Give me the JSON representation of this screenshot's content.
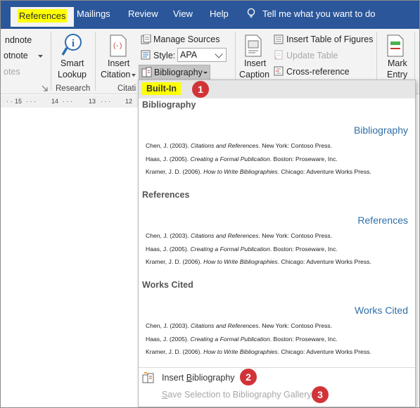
{
  "tabs": {
    "references": "References",
    "mailings": "Mailings",
    "review": "Review",
    "view": "View",
    "help": "Help",
    "tell_me": "Tell me what you want to do"
  },
  "ribbon": {
    "endnote": "ndnote",
    "footnotes_dropdown": "otnote",
    "notes_group": "otes",
    "smart_lookup": [
      "Smart",
      "Lookup"
    ],
    "research_group": "Research",
    "insert_citation": [
      "Insert",
      "Citation"
    ],
    "citations_group": "Citati",
    "manage_sources": "Manage Sources",
    "style_label": "Style:",
    "style_value": "APA",
    "bibliography": "Bibliography",
    "insert_caption": [
      "Insert",
      "Caption"
    ],
    "insert_table_of_figures": "Insert Table of Figures",
    "update_table": "Update Table",
    "cross_reference": "Cross-reference",
    "mark_entry": [
      "Mark",
      "Entry"
    ]
  },
  "ruler_marks": [
    "15",
    "14",
    "13",
    "12"
  ],
  "dropdown": {
    "header": "Built-In",
    "sections": [
      {
        "label": "Bibliography",
        "heading": "Bibliography",
        "entries": [
          {
            "pre": "Chen, J. (2003). ",
            "title": "Citations and References",
            "post": ". New York: Contoso Press."
          },
          {
            "pre": "Haas, J. (2005). ",
            "title": "Creating a Formal Publication",
            "post": ". Boston: Proseware, Inc."
          },
          {
            "pre": "Kramer, J. D. (2006). ",
            "title": "How to Write Bibliographies",
            "post": ". Chicago: Adventure Works Press."
          }
        ]
      },
      {
        "label": "References",
        "heading": "References",
        "entries": [
          {
            "pre": "Chen, J. (2003). ",
            "title": "Citations and References",
            "post": ". New York: Contoso Press."
          },
          {
            "pre": "Haas, J. (2005). ",
            "title": "Creating a Formal Publication",
            "post": ". Boston: Proseware, Inc."
          },
          {
            "pre": "Kramer, J. D. (2006). ",
            "title": "How to Write Bibliographies",
            "post": ". Chicago: Adventure Works Press."
          }
        ]
      },
      {
        "label": "Works Cited",
        "heading": "Works Cited",
        "entries": [
          {
            "pre": "Chen, J. (2003). ",
            "title": "Citations and References",
            "post": ". New York: Contoso Press."
          },
          {
            "pre": "Haas, J. (2005). ",
            "title": "Creating a Formal Publication",
            "post": ". Boston: Proseware, Inc."
          },
          {
            "pre": "Kramer, J. D. (2006). ",
            "title": "How to Write Bibliographies",
            "post": ". Chicago: Adventure Works Press."
          }
        ]
      }
    ],
    "insert_bibliography": {
      "pre": "Insert ",
      "underline": "B",
      "post": "ibliography"
    },
    "save_selection": {
      "underline": "S",
      "post": "ave Selection to Bibliography Gallery..."
    }
  },
  "callouts": [
    "1",
    "2",
    "3"
  ],
  "colors": {
    "tab_bar": "#2b579a",
    "highlight": "#ffff00",
    "callout": "#d13438",
    "heading_blue": "#2f6fa8"
  }
}
